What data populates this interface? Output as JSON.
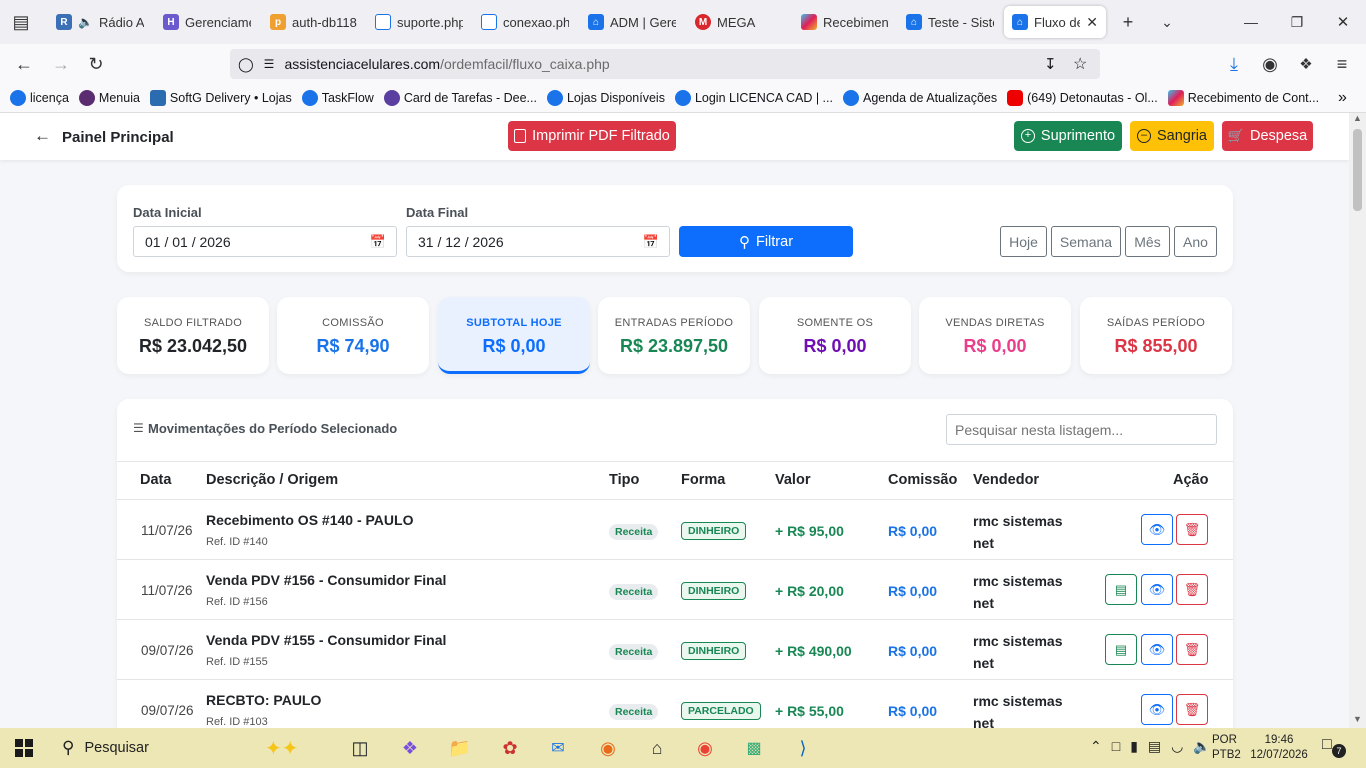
{
  "browser": {
    "tabs": [
      {
        "label": "Rádio A",
        "icon": "radio-icon"
      },
      {
        "label": "Gerenciame",
        "icon": "gerenciamento-icon"
      },
      {
        "label": "auth-db118",
        "icon": "phpmyadmin-icon"
      },
      {
        "label": "suporte.php",
        "icon": "page-icon"
      },
      {
        "label": "conexao.php",
        "icon": "page-icon"
      },
      {
        "label": "ADM | Gere",
        "icon": "home-icon"
      },
      {
        "label": "MEGA",
        "icon": "mega-icon"
      },
      {
        "label": "Recebiment",
        "icon": "slack-icon"
      },
      {
        "label": "Teste - Siste",
        "icon": "home-icon"
      },
      {
        "label": "Fluxo de",
        "icon": "home-icon"
      }
    ],
    "url_host": "assistenciacelulares.com",
    "url_path": "/ordemfacil/fluxo_caixa.php",
    "bookmarks": [
      "licença",
      "Menuia",
      "SoftG Delivery • Lojas",
      "TaskFlow",
      "Card de Tarefas - Dee...",
      "Lojas Disponíveis",
      "Login LICENCA CAD  | ...",
      "Agenda de Atualizações",
      "(649) Detonautas - Ol...",
      "Recebimento de Cont..."
    ]
  },
  "header": {
    "back_label": "Painel Principal",
    "pdf_label": "Imprimir PDF Filtrado",
    "suprimento_label": "Suprimento",
    "sangria_label": "Sangria",
    "despesa_label": "Despesa"
  },
  "filter": {
    "start_label": "Data Inicial",
    "start_value": "01 / 01 / 2026",
    "end_label": "Data Final",
    "end_value": "31 / 12 / 2026",
    "filter_label": "Filtrar",
    "quick": [
      "Hoje",
      "Semana",
      "Mês",
      "Ano"
    ]
  },
  "stats": [
    {
      "label": "SALDO FILTRADO",
      "value": "R$ 23.042,50",
      "color": "#212529"
    },
    {
      "label": "COMISSÃO",
      "value": "R$ 74,90",
      "color": "#1a73e8"
    },
    {
      "label": "SUBTOTAL HOJE",
      "value": "R$ 0,00",
      "color": "#0d6efd"
    },
    {
      "label": "ENTRADAS PERÍODO",
      "value": "R$ 23.897,50",
      "color": "#198754"
    },
    {
      "label": "SOMENTE OS",
      "value": "R$ 0,00",
      "color": "#6f0fb3"
    },
    {
      "label": "VENDAS DIRETAS",
      "value": "R$ 0,00",
      "color": "#e83e8c"
    },
    {
      "label": "SAÍDAS PERÍODO",
      "value": "R$ 855,00",
      "color": "#dc3545"
    }
  ],
  "table": {
    "title": "Movimentações do Período Selecionado",
    "search_placeholder": "Pesquisar nesta listagem...",
    "headers": [
      "Data",
      "Descrição / Origem",
      "Tipo",
      "Forma",
      "Valor",
      "Comissão",
      "Vendedor",
      "Ação"
    ],
    "rows": [
      {
        "date": "11/07/26",
        "desc": "Recebimento OS #140 - PAULO",
        "ref": "Ref. ID #140",
        "tipo": "Receita",
        "forma": "DINHEIRO",
        "valor": "+ R$ 95,00",
        "comissao": "R$ 0,00",
        "vendedor1": "rmc sistemas",
        "vendedor2": "net"
      },
      {
        "date": "11/07/26",
        "desc": "Venda PDV #156 - Consumidor Final",
        "ref": "Ref. ID #156",
        "tipo": "Receita",
        "forma": "DINHEIRO",
        "valor": "+ R$ 20,00",
        "comissao": "R$ 0,00",
        "vendedor1": "rmc sistemas",
        "vendedor2": "net"
      },
      {
        "date": "09/07/26",
        "desc": "Venda PDV #155 - Consumidor Final",
        "ref": "Ref. ID #155",
        "tipo": "Receita",
        "forma": "DINHEIRO",
        "valor": "+ R$ 490,00",
        "comissao": "R$ 0,00",
        "vendedor1": "rmc sistemas",
        "vendedor2": "net"
      },
      {
        "date": "09/07/26",
        "desc": "RECBTO: PAULO",
        "ref": "Ref. ID #103",
        "tipo": "Receita",
        "forma": "PARCELADO",
        "valor": "+ R$ 55,00",
        "comissao": "R$ 0,00",
        "vendedor1": "rmc sistemas",
        "vendedor2": "net"
      }
    ]
  },
  "taskbar": {
    "search_label": "Pesquisar",
    "lang1": "POR",
    "lang2": "PTB2",
    "time": "19:46",
    "date": "12/07/2026",
    "notifications": "7"
  }
}
